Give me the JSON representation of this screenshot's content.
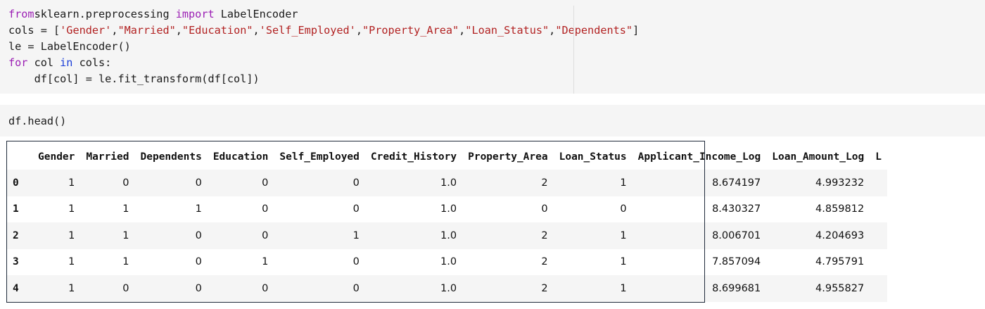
{
  "cell1": {
    "lines": [
      [
        [
          "kw-purple",
          "from"
        ],
        [
          "",
          "sklearn.preprocessing "
        ],
        [
          "kw-purple",
          "import"
        ],
        [
          "",
          " LabelEncoder"
        ]
      ],
      [
        [
          "",
          "cols = ["
        ],
        [
          "str",
          "'Gender'"
        ],
        [
          "",
          ","
        ],
        [
          "str",
          "\"Married\""
        ],
        [
          "",
          ","
        ],
        [
          "str",
          "\"Education\""
        ],
        [
          "",
          ","
        ],
        [
          "str",
          "'Self_Employed'"
        ],
        [
          "",
          ","
        ],
        [
          "str",
          "\"Property_Area\""
        ],
        [
          "",
          ","
        ],
        [
          "str",
          "\"Loan_Status\""
        ],
        [
          "",
          ","
        ],
        [
          "str",
          "\"Dependents\""
        ],
        [
          "",
          "]"
        ]
      ],
      [
        [
          "",
          "le = LabelEncoder()"
        ]
      ],
      [
        [
          "kw-purple",
          "for"
        ],
        [
          "",
          " col "
        ],
        [
          "kw-blue",
          "in"
        ],
        [
          "",
          " cols:"
        ]
      ],
      [
        [
          "",
          "    df[col] = le.fit_transform(df[col])"
        ]
      ]
    ]
  },
  "cell2": {
    "code": "df.head()"
  },
  "table": {
    "columns": [
      "",
      "Gender",
      "Married",
      "Dependents",
      "Education",
      "Self_Employed",
      "Credit_History",
      "Property_Area",
      "Loan_Status",
      "Applicant_Income_Log",
      "Loan_Amount_Log",
      "L"
    ],
    "rows": [
      [
        "0",
        "1",
        "0",
        "0",
        "0",
        "0",
        "1.0",
        "2",
        "1",
        "8.674197",
        "4.993232",
        ""
      ],
      [
        "1",
        "1",
        "1",
        "1",
        "0",
        "0",
        "1.0",
        "0",
        "0",
        "8.430327",
        "4.859812",
        ""
      ],
      [
        "2",
        "1",
        "1",
        "0",
        "0",
        "1",
        "1.0",
        "2",
        "1",
        "8.006701",
        "4.204693",
        ""
      ],
      [
        "3",
        "1",
        "1",
        "0",
        "1",
        "0",
        "1.0",
        "2",
        "1",
        "7.857094",
        "4.795791",
        ""
      ],
      [
        "4",
        "1",
        "0",
        "0",
        "0",
        "0",
        "1.0",
        "2",
        "1",
        "8.699681",
        "4.955827",
        ""
      ]
    ]
  }
}
